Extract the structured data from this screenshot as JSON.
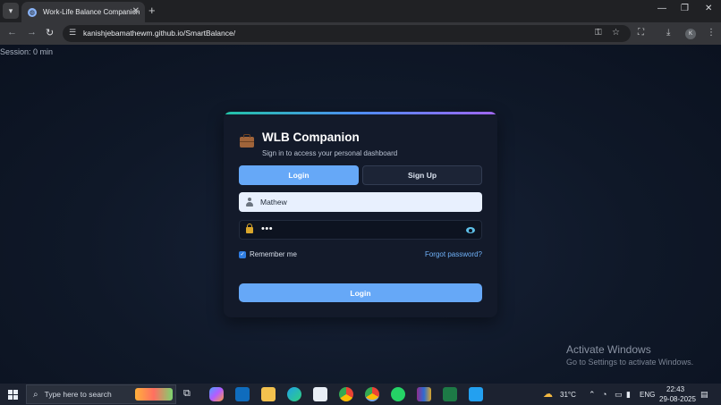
{
  "browser": {
    "tab_title": "Work-Life Balance Companion",
    "url": "kanishjebamathewm.github.io/SmartBalance/",
    "profile_initial": "K",
    "icons": {
      "tab_menu": "chevron-down-icon",
      "favicon": "globe-icon",
      "close_tab": "close-icon",
      "new_tab": "plus-icon",
      "minimize": "minimize-icon",
      "restore": "restore-icon",
      "close_window": "close-window-icon",
      "back": "back-arrow-icon",
      "forward": "forward-arrow-icon",
      "reload": "reload-icon",
      "site_info": "tune-icon",
      "password": "key-icon",
      "bookmark": "star-icon",
      "translate": "translate-icon",
      "download": "download-icon",
      "menu": "more-vertical-icon"
    }
  },
  "page": {
    "session": "Session: 0 min",
    "title": "WLB Companion",
    "subtitle": "Sign in to access your personal dashboard",
    "tabs": {
      "login": "Login",
      "signup": "Sign Up"
    },
    "username": "Mathew",
    "password_mask": "•••",
    "remember_label": "Remember me",
    "remember_checked": true,
    "forgot_label": "Forgot password?",
    "submit_label": "Login",
    "accent_color": "#66a8f7",
    "activate_title": "Activate Windows",
    "activate_sub": "Go to Settings to activate Windows."
  },
  "taskbar": {
    "search_placeholder": "Type here to search",
    "weather": "31°C",
    "language": "ENG",
    "time": "22:43",
    "date": "29-08-2025",
    "apps": [
      "task-view-icon",
      "copilot-icon",
      "outlook-icon",
      "file-explorer-icon",
      "edge-icon",
      "store-icon",
      "chrome-icon",
      "chrome-active-icon",
      "whatsapp-icon",
      "winrar-icon",
      "excel-icon",
      "vscode-icon"
    ]
  }
}
